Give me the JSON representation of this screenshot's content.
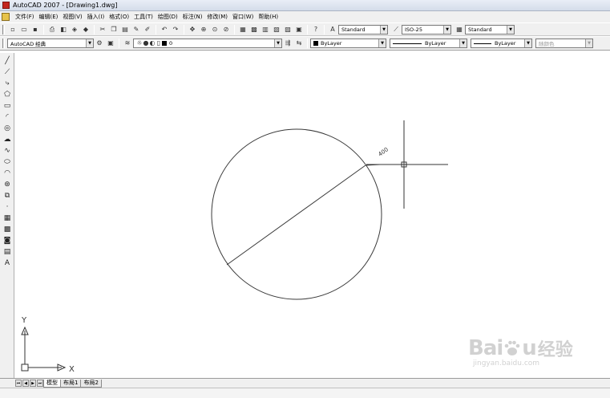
{
  "window": {
    "title": "AutoCAD 2007 - [Drawing1.dwg]"
  },
  "menu": [
    "文件(F)",
    "编辑(E)",
    "视图(V)",
    "插入(I)",
    "格式(O)",
    "工具(T)",
    "绘图(D)",
    "标注(N)",
    "修改(M)",
    "窗口(W)",
    "帮助(H)"
  ],
  "styles": {
    "text_style": "Standard",
    "dim_style": "ISO-25",
    "table_style": "Standard"
  },
  "workspace": {
    "name": "AutoCAD 经典"
  },
  "layer": {
    "current": "0"
  },
  "properties": {
    "color": "ByLayer",
    "linetype": "ByLayer",
    "lineweight": "ByLayer",
    "plotstyle": "随颜色"
  },
  "drawing": {
    "dimension_text": "400",
    "ucs_x": "X",
    "ucs_y": "Y"
  },
  "tabs": [
    "模型",
    "布局1",
    "布局2"
  ],
  "watermark": {
    "brand": "Bai",
    "brand_end": "u",
    "chinese": "经验",
    "url": "jingyan.baidu.com"
  },
  "colors": {
    "titlebar": "#d4dcea",
    "panel": "#f0f0f0",
    "canvas": "#ffffff",
    "entity": "#3a3a3a"
  }
}
